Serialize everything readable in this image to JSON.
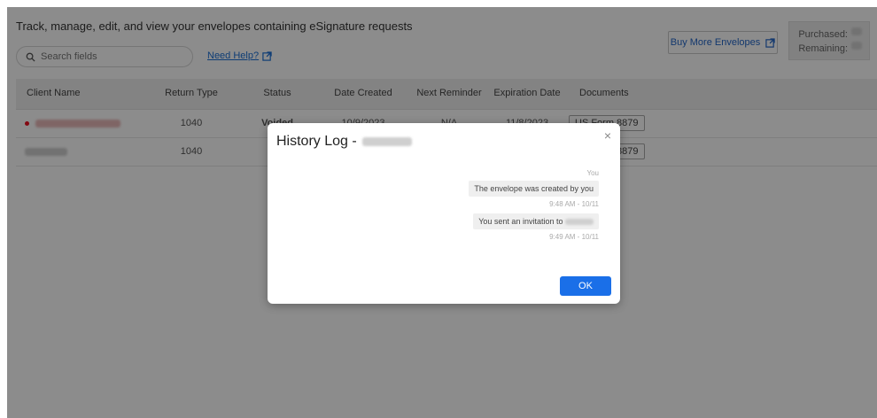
{
  "header": {
    "title": "Track, manage, edit, and view your envelopes containing eSignature requests",
    "search_placeholder": "Search fields",
    "help_label": "Need Help?"
  },
  "envelopes": {
    "buy_label": "Buy More Envelopes",
    "purchased_label": "Purchased:",
    "remaining_label": "Remaining:"
  },
  "table": {
    "columns": [
      "Client Name",
      "Return Type",
      "Status",
      "Date Created",
      "Next Reminder",
      "Expiration Date",
      "Documents"
    ],
    "rows": [
      {
        "return_type": "1040",
        "status": "Voided",
        "date_created": "10/9/2023",
        "next_reminder": "N/A",
        "expiration": "11/8/2023",
        "document": "US Form 8879"
      },
      {
        "return_type": "1040",
        "status": "",
        "date_created": "",
        "next_reminder": "",
        "expiration": "",
        "document": "US Form 8879"
      }
    ]
  },
  "modal": {
    "title": "History Log -",
    "close": "×",
    "sender": "You",
    "entries": [
      {
        "text": "The envelope was created by you",
        "time": "9:48 AM - 10/11"
      },
      {
        "text": "You sent an invitation to",
        "time": "9:49 AM - 10/11"
      }
    ],
    "ok_label": "OK"
  },
  "colors": {
    "accent": "#1a6fe8",
    "voided": "#dd1111",
    "overlay": "rgba(0,0,0,0.45)"
  }
}
